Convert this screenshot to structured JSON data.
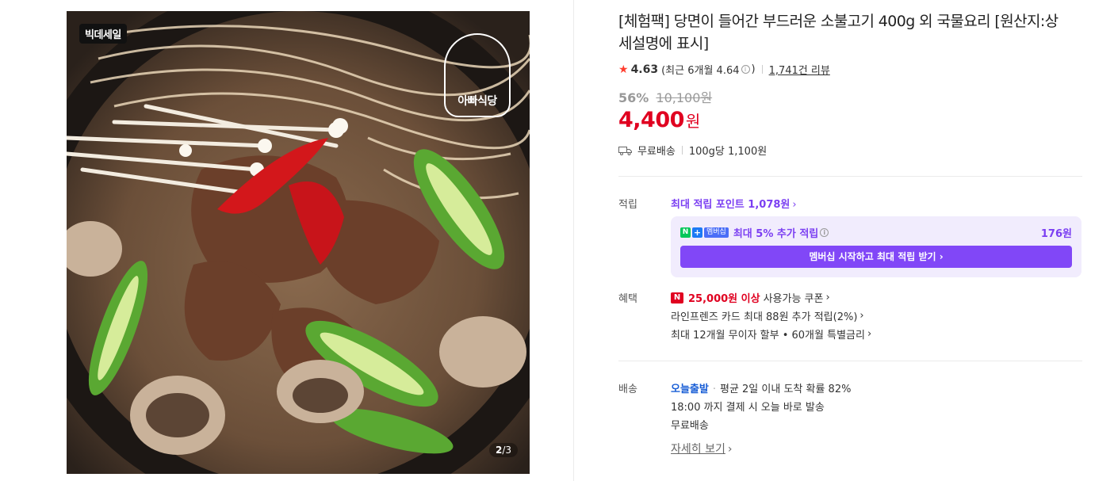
{
  "image": {
    "sale_badge": "빅데세일",
    "logo_text": "아빠식당",
    "page_current": "2",
    "page_total": "/3"
  },
  "product": {
    "title": "[체험팩] 당면이 들어간 부드러운 소불고기 400g 외 국물요리 [원산지:상세설명에 표시]",
    "rating": "4.63",
    "recent_rating_text": "(최근 6개월 4.64",
    "recent_rating_close": ")",
    "review_count": "1,741건 리뷰",
    "discount_percent": "56%",
    "original_price": "10,100원",
    "sale_price": "4,400",
    "price_unit": "원",
    "shipping": "무료배송",
    "unit_price": "100g당 1,100원"
  },
  "points": {
    "label": "적립",
    "max_point_text": "최대 적립 포인트 1,078원",
    "member_tag": "멤버십",
    "member_text": "최대 5% 추가 적립",
    "member_amount": "176원",
    "member_button": "멤버십 시작하고 최대 적립 받기"
  },
  "benefits": {
    "label": "혜택",
    "coupon_amount": "25,000원 이상",
    "coupon_text": "사용가능 쿠폰",
    "card_text": "라인프렌즈 카드 최대 88원 추가 적립(2%)",
    "installment_text": "최대 12개월 무이자 할부 • 60개월 특별금리"
  },
  "delivery": {
    "label": "배송",
    "today_ship": "오늘출발",
    "arrival_text": "평균 2일 이내 도착 확률 82%",
    "cutoff_text": "18:00 까지 결제 시 오늘 바로 발송",
    "free_ship": "무료배송",
    "detail_link": "자세히 보기"
  },
  "colors": {
    "price_red": "#e00020",
    "point_purple": "#7b3ff2",
    "member_button": "#8147f7",
    "star": "#ff3d2e",
    "today_ship_blue": "#1a5fd6"
  }
}
